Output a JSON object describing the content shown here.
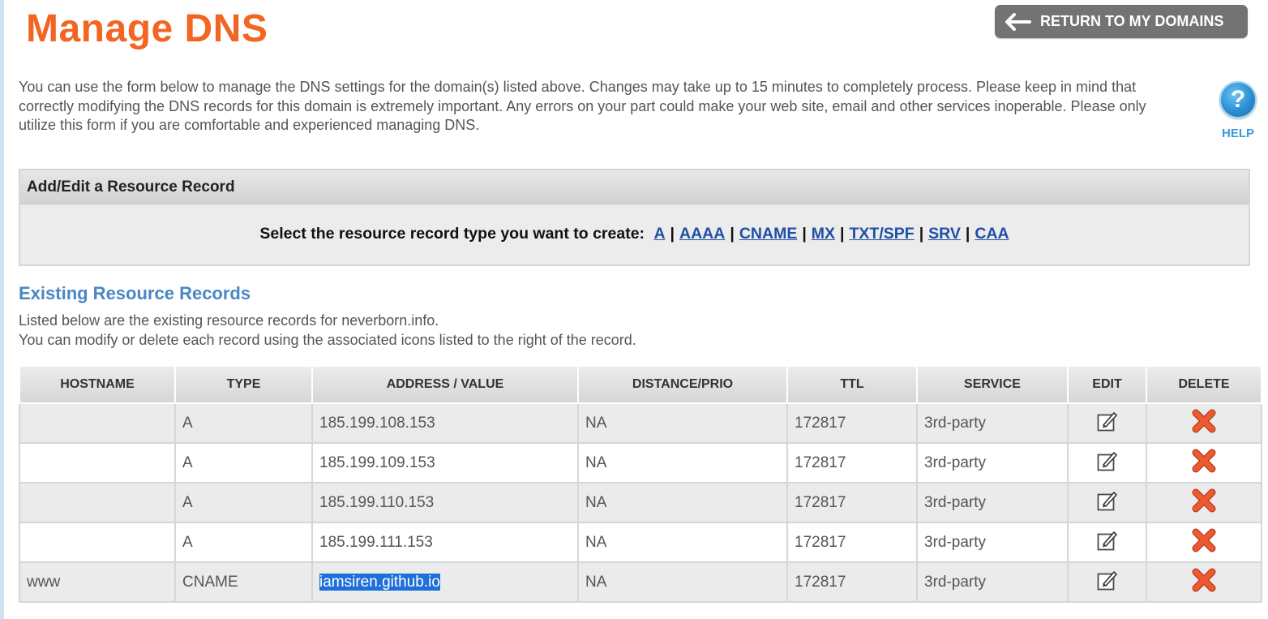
{
  "page": {
    "title": "Manage DNS",
    "return_button_label": "RETURN TO MY DOMAINS",
    "intro_text": "You can use the form below to manage the DNS settings for the domain(s) listed above. Changes may take up to 15 minutes to completely process. Please keep in mind that correctly modifying the DNS records for this domain is extremely important. Any errors on your part could make your web site, email and other services inoperable. Please only utilize this form if you are comfortable and experienced managing DNS.",
    "help_label": "HELP",
    "help_glyph": "?"
  },
  "add_panel": {
    "header": "Add/Edit a Resource Record",
    "prompt": "Select the resource record type you want to create:",
    "record_types": [
      "A",
      "AAAA",
      "CNAME",
      "MX",
      "TXT/SPF",
      "SRV",
      "CAA"
    ]
  },
  "existing": {
    "title": "Existing Resource Records",
    "desc_line1": "Listed below are the existing resource records for neverborn.info.",
    "desc_line2": "You can modify or delete each record using the associated icons listed to the right of the record.",
    "columns": [
      "HOSTNAME",
      "TYPE",
      "ADDRESS / VALUE",
      "DISTANCE/PRIO",
      "TTL",
      "SERVICE",
      "EDIT",
      "DELETE"
    ],
    "rows": [
      {
        "hostname": "",
        "type": "A",
        "address": "185.199.108.153",
        "distance": "NA",
        "ttl": "172817",
        "service": "3rd-party",
        "selected": false
      },
      {
        "hostname": "",
        "type": "A",
        "address": "185.199.109.153",
        "distance": "NA",
        "ttl": "172817",
        "service": "3rd-party",
        "selected": false
      },
      {
        "hostname": "",
        "type": "A",
        "address": "185.199.110.153",
        "distance": "NA",
        "ttl": "172817",
        "service": "3rd-party",
        "selected": false
      },
      {
        "hostname": "",
        "type": "A",
        "address": "185.199.111.153",
        "distance": "NA",
        "ttl": "172817",
        "service": "3rd-party",
        "selected": false
      },
      {
        "hostname": "www",
        "type": "CNAME",
        "address": "iamsiren.github.io",
        "distance": "NA",
        "ttl": "172817",
        "service": "3rd-party",
        "selected": true
      }
    ]
  },
  "icons": {
    "return": "arrow-left-icon",
    "help": "help-question-icon",
    "edit": "edit-pencil-icon",
    "delete": "delete-x-icon"
  },
  "colors": {
    "title": "#f26522",
    "button_bg": "#737373",
    "link": "#1f4fa6",
    "section_title": "#4a86c5",
    "help": "#3a9ad9",
    "delete_x": "#e8502a",
    "selection": "#1e6fd9"
  }
}
